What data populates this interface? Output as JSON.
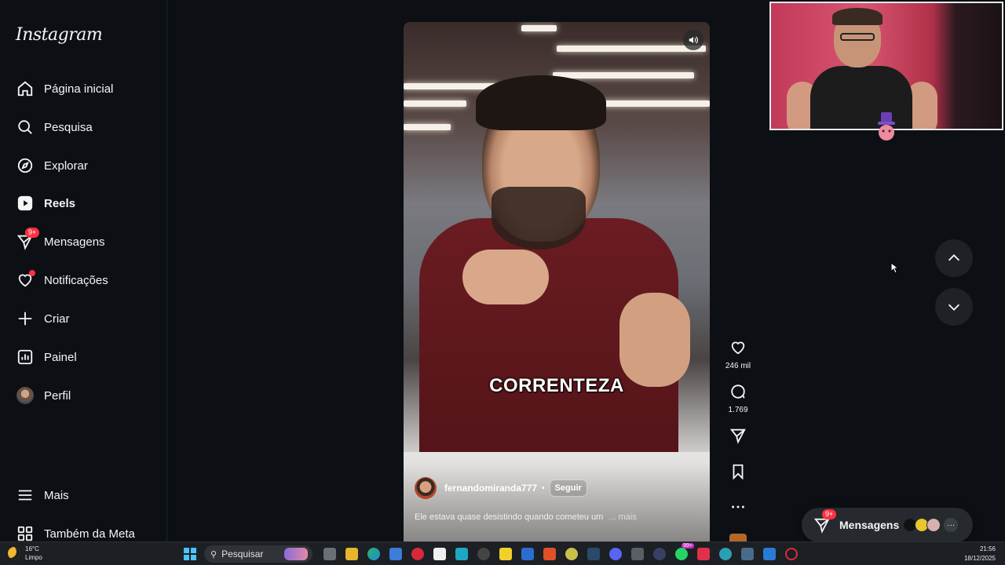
{
  "app": {
    "logo": "Instagram"
  },
  "sidebar": {
    "items": [
      {
        "label": "Página inicial",
        "icon": "home-icon",
        "active": false
      },
      {
        "label": "Pesquisa",
        "icon": "search-icon",
        "active": false
      },
      {
        "label": "Explorar",
        "icon": "compass-icon",
        "active": false
      },
      {
        "label": "Reels",
        "icon": "reels-icon",
        "active": true
      },
      {
        "label": "Mensagens",
        "icon": "messenger-icon",
        "active": false,
        "badge": "9+"
      },
      {
        "label": "Notificações",
        "icon": "heart-icon",
        "active": false,
        "dot": true
      },
      {
        "label": "Criar",
        "icon": "plus-icon",
        "active": false
      },
      {
        "label": "Painel",
        "icon": "dashboard-icon",
        "active": false
      },
      {
        "label": "Perfil",
        "icon": "avatar",
        "active": false
      }
    ],
    "more": "Mais",
    "meta": "Também da Meta"
  },
  "reel": {
    "overlay_text": "CORRENTEZA",
    "author": "fernandomiranda777",
    "separator": "•",
    "follow_label": "Seguir",
    "description": "Ele estava quase desistindo quando cometeu um",
    "more_label": "... mais"
  },
  "actions": {
    "likes": "246 mil",
    "comments": "1.769"
  },
  "messages_pill": {
    "label": "Mensagens",
    "badge": "9+"
  },
  "taskbar": {
    "weather_temp": "16°C",
    "weather_desc": "Limpo",
    "search_placeholder": "Pesquisar",
    "app_badge": "99+",
    "time": "21:56",
    "date": "18/12/2025"
  },
  "colors": {
    "background": "#0c1014",
    "badge": "#ff3040",
    "reel_vest": "#6a1c22",
    "accent_windows": "#4cc2ff"
  }
}
